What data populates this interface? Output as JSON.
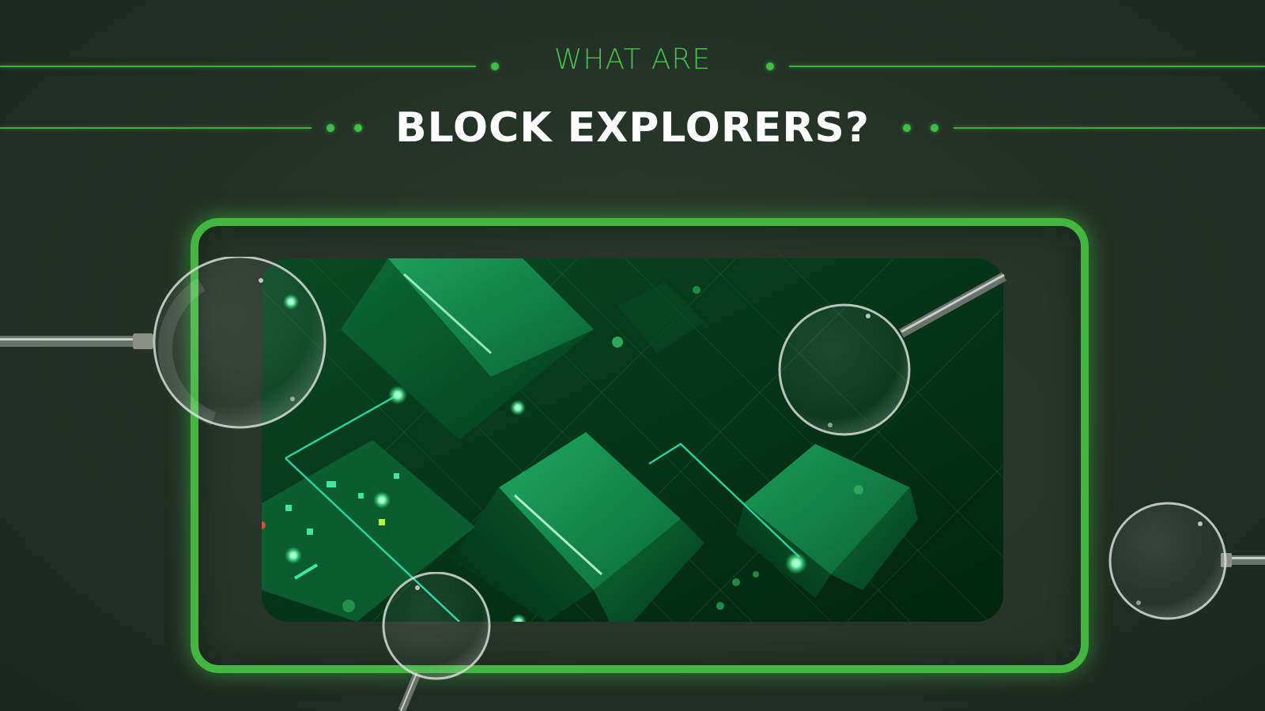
{
  "header": {
    "subtitle": "WHAT ARE",
    "title": "BLOCK EXPLORERS?"
  },
  "colors": {
    "background": "#212e25",
    "accent_green": "#42b641",
    "title_white": "#ffffff",
    "screen_dark_green": "#032a10"
  },
  "illustration": {
    "subject": "isometric green blockchain blocks connected by glowing lines",
    "magnifying_glass_count": 4
  }
}
